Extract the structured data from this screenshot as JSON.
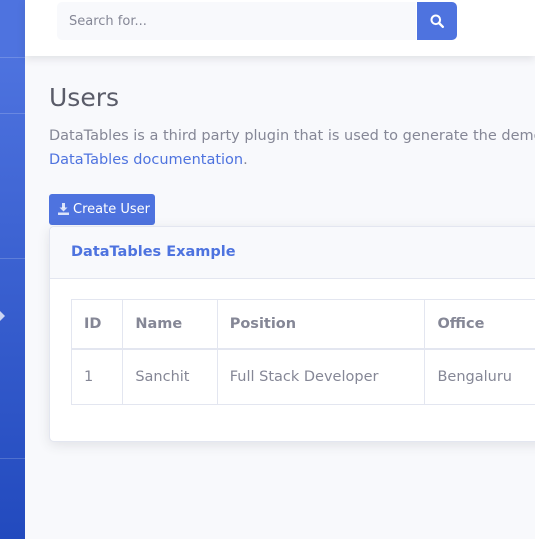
{
  "search": {
    "placeholder": "Search for...",
    "icon": "search-icon"
  },
  "page": {
    "title": "Users",
    "description": "DataTables is a third party plugin that is used to generate the demo t",
    "description_link": "DataTables documentation",
    "description_end": "."
  },
  "actions": {
    "create_user_label": "Create User",
    "create_user_icon": "download-icon"
  },
  "card": {
    "title": "DataTables Example"
  },
  "table": {
    "columns": [
      "ID",
      "Name",
      "Position",
      "Office"
    ],
    "rows": [
      [
        "1",
        "Sanchit",
        "Full Stack Developer",
        "Bengaluru"
      ]
    ]
  },
  "colors": {
    "primary": "#4e73df",
    "text": "#858796",
    "heading": "#5a5c69",
    "background": "#f8f9fc"
  }
}
